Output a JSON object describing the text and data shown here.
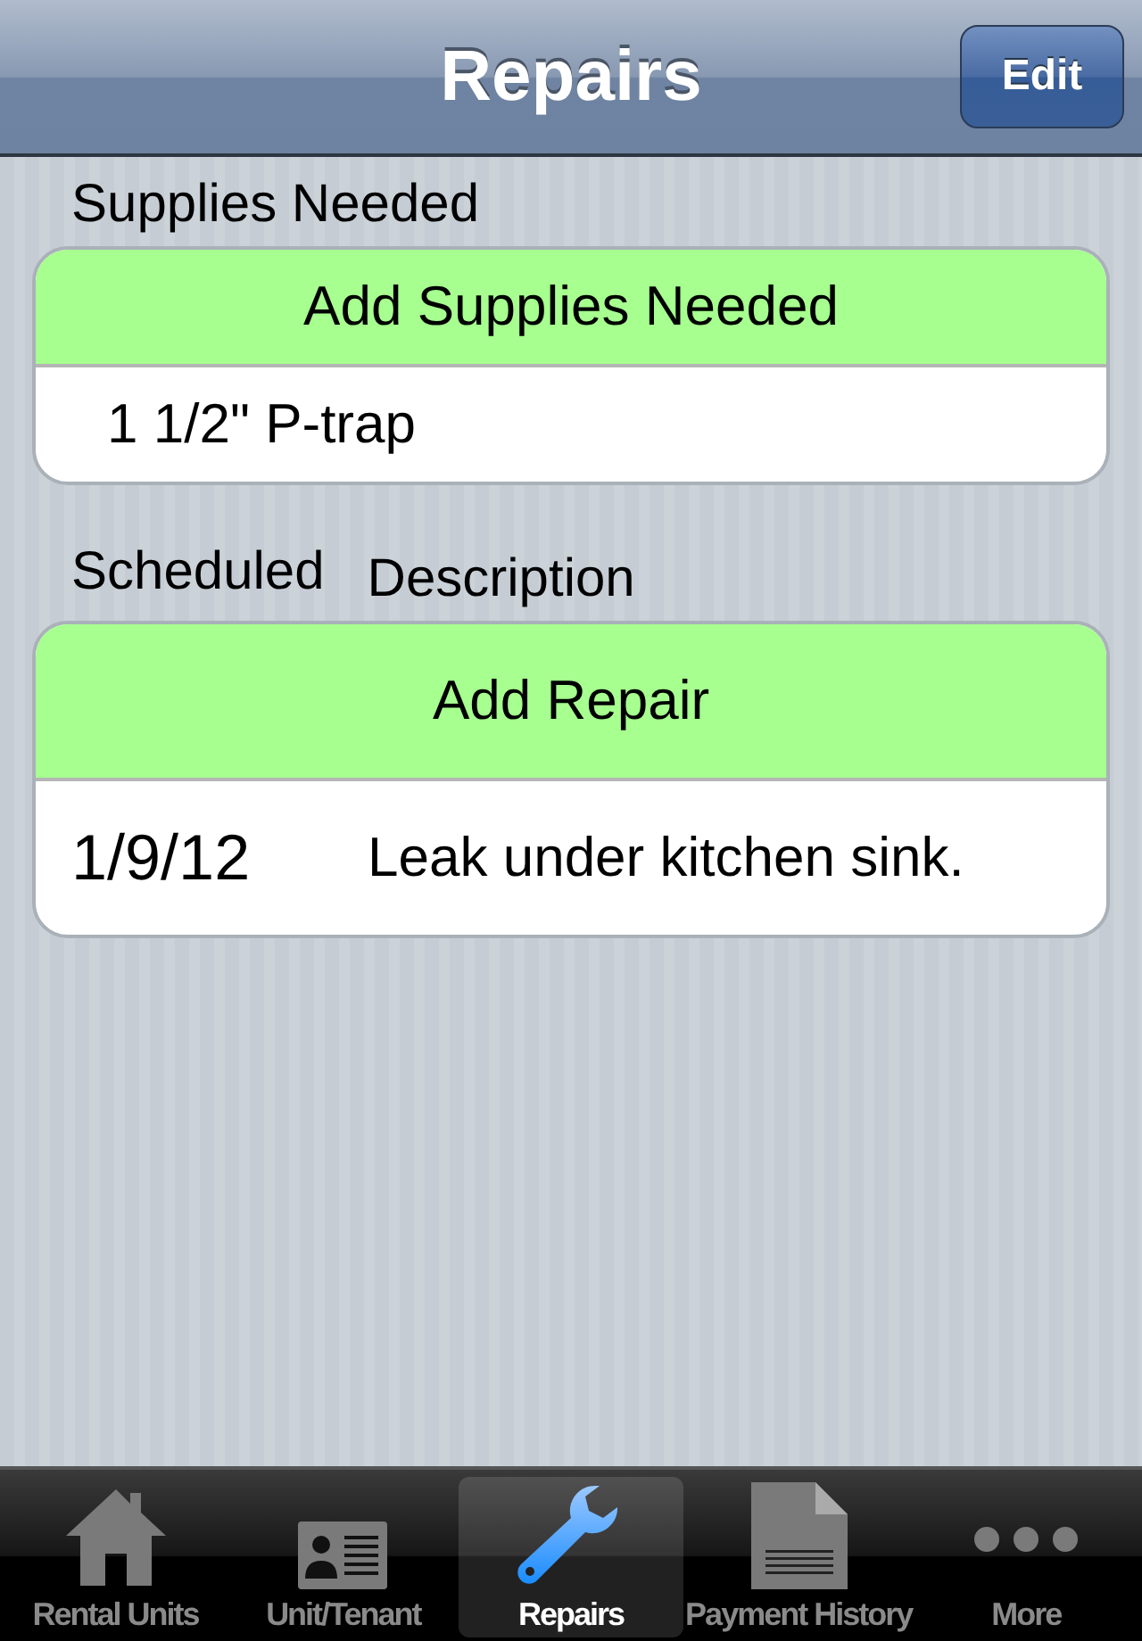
{
  "nav": {
    "title": "Repairs",
    "edit_button": "Edit"
  },
  "supplies": {
    "header": "Supplies Needed",
    "add_button": "Add Supplies Needed",
    "items": [
      "1 1/2\" P-trap"
    ]
  },
  "repairs": {
    "header_columns": [
      "Scheduled",
      "Description"
    ],
    "add_button": "Add Repair",
    "rows": [
      {
        "date": "1/9/12",
        "description": "Leak under kitchen sink."
      }
    ]
  },
  "tab_bar": [
    {
      "label": "Rental Units",
      "kind": "house",
      "selected": false
    },
    {
      "label": "Unit/Tenant",
      "kind": "card",
      "selected": false
    },
    {
      "label": "Repairs",
      "kind": "wrench",
      "selected": true
    },
    {
      "label": "Payment History",
      "kind": "document",
      "selected": false
    },
    {
      "label": "More",
      "kind": "dots",
      "selected": false
    }
  ]
}
